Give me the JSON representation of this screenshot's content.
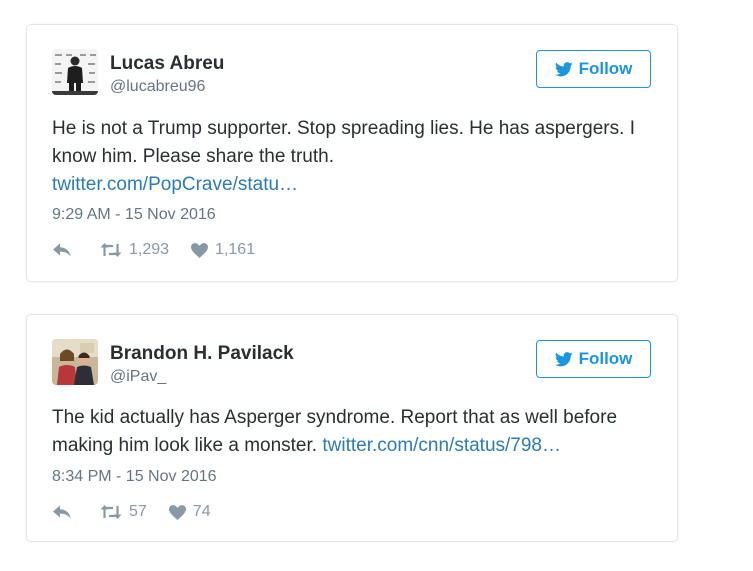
{
  "tweets": [
    {
      "author_name": "Lucas Abreu",
      "author_handle": "@lucabreu96",
      "follow_label": "Follow",
      "text_before_link": "He is not a Trump supporter. Stop spreading lies. He has aspergers. I know him. Please share the truth.",
      "link_text": "twitter.com/PopCrave/statu…",
      "timestamp": "9:29 AM - 15 Nov 2016",
      "retweet_count": "1,293",
      "like_count": "1,161"
    },
    {
      "author_name": "Brandon H. Pavilack",
      "author_handle": "@iPav_",
      "follow_label": "Follow",
      "text_before_link": "The kid actually has Asperger syndrome. Report that as well before making him look like a monster.",
      "link_text": "twitter.com/cnn/status/798…",
      "timestamp": "8:34 PM - 15 Nov 2016",
      "retweet_count": "57",
      "like_count": "74"
    }
  ],
  "icons": {
    "follow": "twitter-bird-icon",
    "reply": "reply-icon",
    "retweet": "retweet-icon",
    "like": "heart-icon"
  },
  "colors": {
    "accent": "#1b95e0",
    "link": "#2b7bb9",
    "text": "#292f33",
    "muted": "#66757f",
    "action": "#8899a6",
    "border": "#e1e8ed"
  }
}
